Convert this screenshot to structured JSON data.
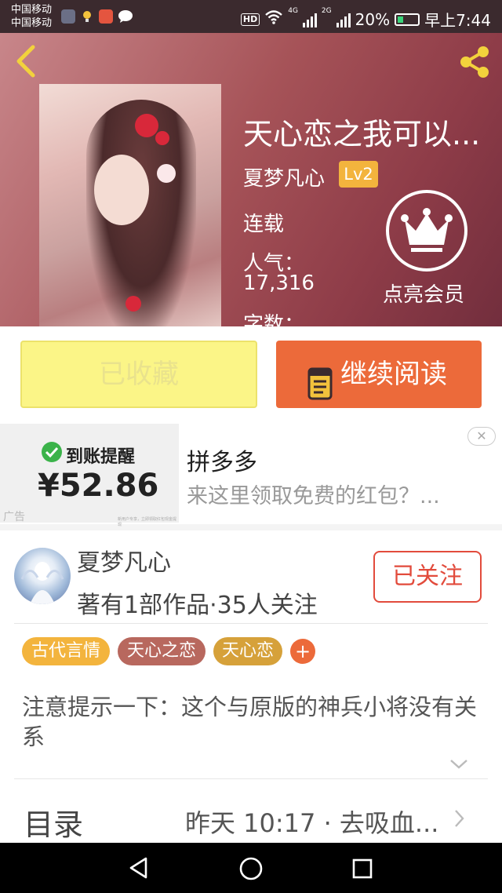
{
  "status_bar": {
    "carrier_1": "中国移动",
    "carrier_2": "中国移动",
    "hd": "HD",
    "net_4g": "4G",
    "net_2g": "2G",
    "battery": "20%",
    "time": "早上7:44"
  },
  "book": {
    "title": "天心恋之我可以...",
    "author": "夏梦凡心",
    "level": "Lv2",
    "serial_status": "连载",
    "popularity_label": "人气：",
    "popularity_value": "17,316",
    "words_label": "字数：",
    "vip_label": "点亮会员"
  },
  "actions": {
    "favorited": "已收藏",
    "continue_reading": "继续阅读"
  },
  "ad": {
    "remind": "到账提醒",
    "amount": "¥52.86",
    "tag": "广告",
    "fine_print": "新用户专享，立即领取红包现金提现",
    "title": "拼多多",
    "desc": "来这里领取免费的红包？...",
    "close": "✕"
  },
  "author_info": {
    "name": "夏梦凡心",
    "stats": "著有1部作品·35人关注",
    "follow": "已关注"
  },
  "tags": [
    {
      "label": "古代言情",
      "color": "#f3b43d"
    },
    {
      "label": "天心之恋",
      "color": "#b8685e"
    },
    {
      "label": "天心恋",
      "color": "#d6a13a"
    },
    {
      "label": "+",
      "color": "#ec6a3a"
    }
  ],
  "intro": "注意提示一下：这个与原版的神兵小将没有关系",
  "toc": {
    "label": "目录",
    "latest": "昨天 10:17 · 去吸血..."
  },
  "colors": {
    "accent_orange": "#ec6a3a",
    "favorite_yellow": "#fbf587",
    "follow_red": "#e24b3c"
  }
}
